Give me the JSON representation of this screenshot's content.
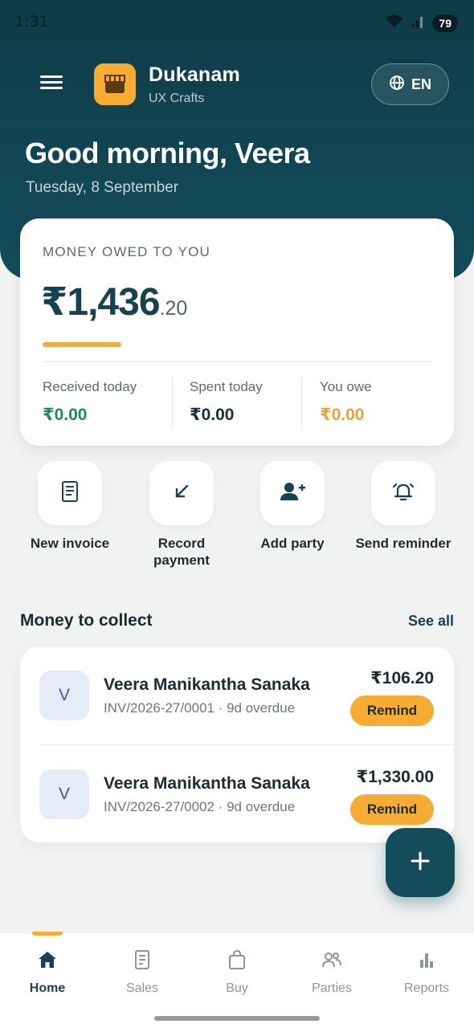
{
  "status_bar": {
    "time": "1:31",
    "battery": "79"
  },
  "header": {
    "app_name": "Dukanam",
    "app_subtitle": "UX Crafts",
    "language": "EN",
    "greeting": "Good morning, Veera",
    "date": "Tuesday, 8 September"
  },
  "summary": {
    "label": "MONEY OWED TO YOU",
    "amount_main": "₹1,436",
    "amount_paise": ".20",
    "stats": [
      {
        "title": "Received today",
        "value": "₹0.00",
        "color": "#1e8a5a"
      },
      {
        "title": "Spent today",
        "value": "₹0.00",
        "color": "#17303b"
      },
      {
        "title": "You owe",
        "value": "₹0.00",
        "color": "#e9a23b"
      }
    ]
  },
  "actions": [
    {
      "label": "New invoice",
      "icon": "invoice-icon"
    },
    {
      "label": "Record payment",
      "icon": "arrow-down-left-icon"
    },
    {
      "label": "Add party",
      "icon": "add-user-icon"
    },
    {
      "label": "Send reminder",
      "icon": "bell-icon"
    }
  ],
  "collect": {
    "title": "Money to collect",
    "see_all": "See all",
    "items": [
      {
        "initial": "V",
        "name": "Veera Manikantha Sanaka",
        "meta": "INV/2026-27/0001 · 9d overdue",
        "amount": "₹106.20",
        "button": "Remind"
      },
      {
        "initial": "V",
        "name": "Veera Manikantha Sanaka",
        "meta": "INV/2026-27/0002 · 9d overdue",
        "amount": "₹1,330.00",
        "button": "Remind"
      }
    ]
  },
  "nav": [
    {
      "label": "Home",
      "icon": "home-icon",
      "active": true
    },
    {
      "label": "Sales",
      "icon": "receipt-icon"
    },
    {
      "label": "Buy",
      "icon": "shopping-bag-icon"
    },
    {
      "label": "Parties",
      "icon": "people-icon"
    },
    {
      "label": "Reports",
      "icon": "bar-chart-icon"
    }
  ],
  "colors": {
    "primary": "#134d5c",
    "accent": "#f6ac33",
    "success": "#1e8a5a"
  }
}
